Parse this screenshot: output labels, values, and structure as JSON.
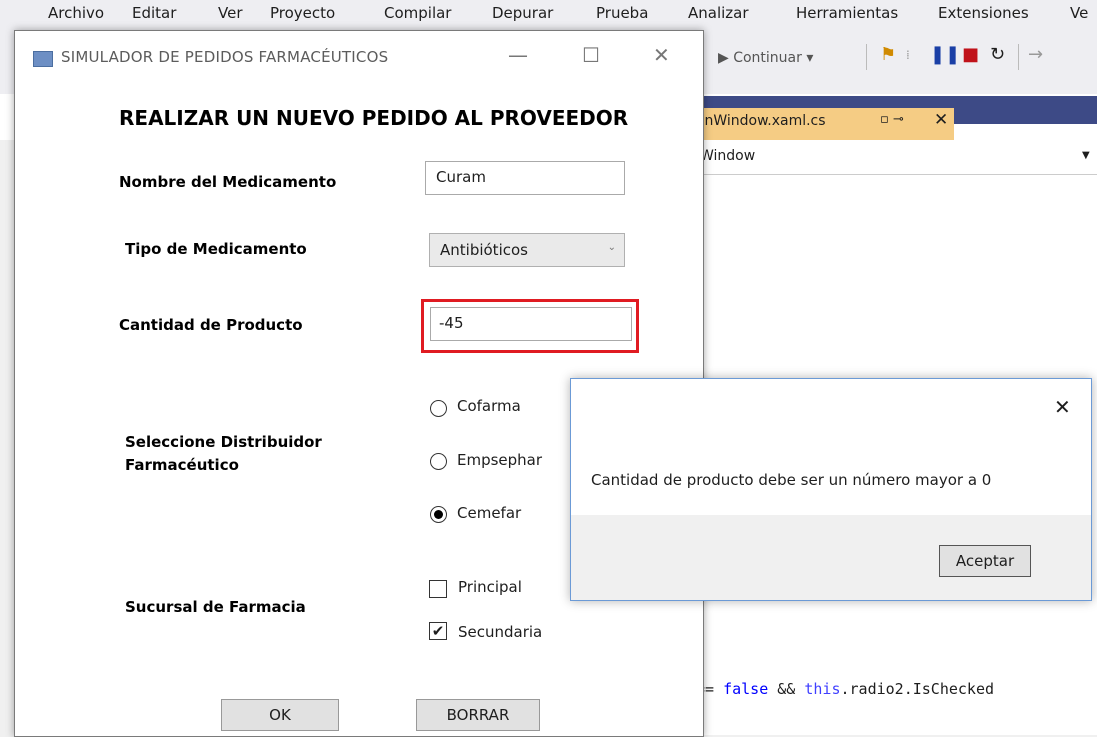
{
  "ide": {
    "menu": [
      "Archivo",
      "Editar",
      "Ver",
      "Proyecto",
      "Compilar",
      "Depurar",
      "Prueba",
      "Analizar",
      "Herramientas",
      "Extensiones",
      "Ve"
    ],
    "continue_label": "▶ Continuar ▾",
    "tab_label": "ainWindow.xaml.cs",
    "nav_label": "Window",
    "code": {
      "part1": "== ",
      "kw1": "false",
      "part2": " && ",
      "kw2": "this",
      "part3": ".radio2.IsChecked"
    }
  },
  "window": {
    "title": "SIMULADOR DE PEDIDOS FARMACÉUTICOS",
    "heading": "REALIZAR UN NUEVO PEDIDO AL PROVEEDOR",
    "fields": {
      "nombre_label": "Nombre del Medicamento",
      "nombre_value": "Curam",
      "tipo_label": "Tipo de Medicamento",
      "tipo_value": "Antibióticos",
      "cantidad_label": "Cantidad de Producto",
      "cantidad_value": "-45",
      "distribuidor_label_1": "Seleccione Distribuidor",
      "distribuidor_label_2": "Farmacéutico",
      "distribuidores": [
        "Cofarma",
        "Empsephar",
        "Cemefar"
      ],
      "distribuidor_selected": "Cemefar",
      "sucursal_label": "Sucursal de Farmacia",
      "sucursales": [
        "Principal",
        "Secundaria"
      ],
      "sucursal_checked": [
        "Secundaria"
      ]
    },
    "buttons": {
      "ok": "OK",
      "borrar": "BORRAR"
    },
    "error_field_color": "#e01b22"
  },
  "dialog": {
    "message": "Cantidad de producto debe ser un número mayor a 0",
    "accept": "Aceptar"
  }
}
